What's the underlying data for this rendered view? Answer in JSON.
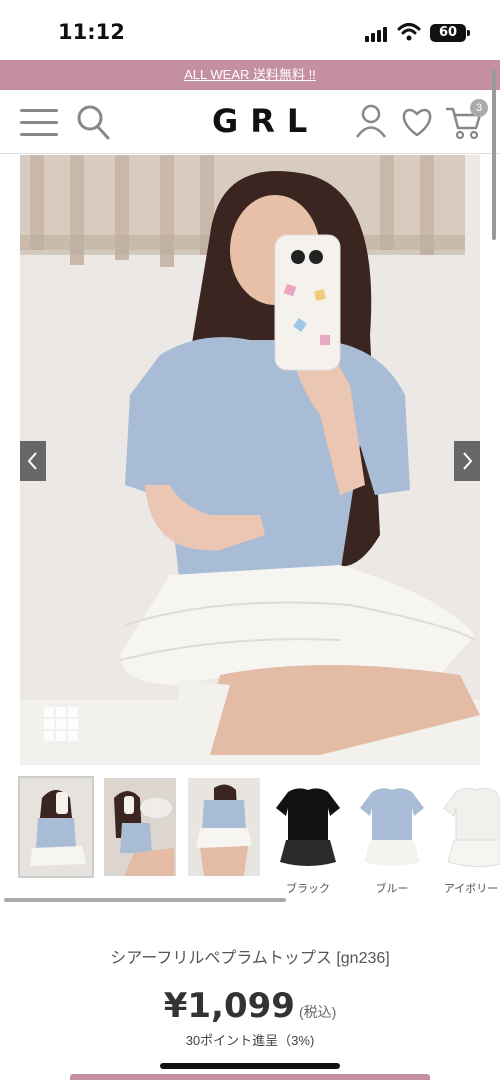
{
  "status": {
    "time": "11:12",
    "battery": "60"
  },
  "promo": {
    "text": "ALL WEAR 送料無料 !!"
  },
  "header": {
    "logo": "GRL",
    "cart_count": "3"
  },
  "thumbnails": [
    {
      "label": ""
    },
    {
      "label": ""
    },
    {
      "label": ""
    },
    {
      "label": "ブラック"
    },
    {
      "label": "ブルー"
    },
    {
      "label": "アイボリー"
    }
  ],
  "product": {
    "name": "シアーフリルペプラムトップス [gn236]",
    "price": "¥1,099",
    "tax": "(税込)",
    "points": "30ポイント進呈（3%)"
  },
  "colors": {
    "accent": "#c48fa1",
    "top_blue": "#a9bcd6"
  }
}
